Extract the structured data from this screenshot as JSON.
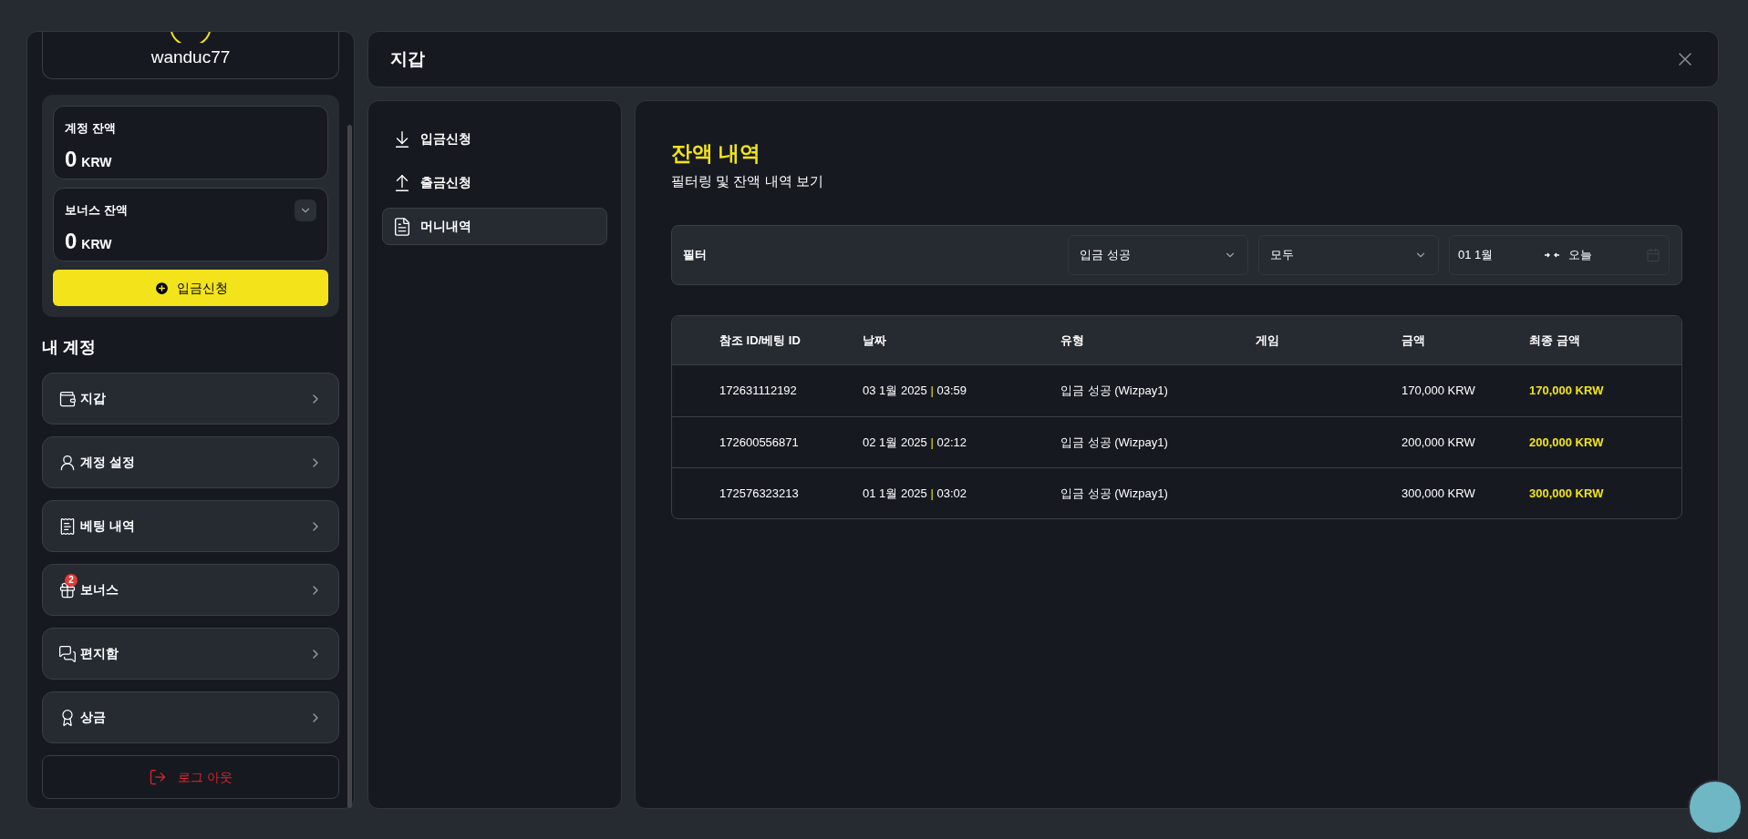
{
  "sidebar": {
    "username": "wanduc77",
    "balances": [
      {
        "label": "계정 잔액",
        "amount": "0",
        "currency": "KRW",
        "expandable": false
      },
      {
        "label": "보너스 잔액",
        "amount": "0",
        "currency": "KRW",
        "expandable": true
      }
    ],
    "deposit_button": "입금신청",
    "section_title": "내 계정",
    "items": [
      {
        "kind": "wallet",
        "label": "지갑"
      },
      {
        "kind": "account",
        "label": "계정 설정"
      },
      {
        "kind": "bets",
        "label": "베팅 내역"
      },
      {
        "kind": "bonus",
        "label": "보너스",
        "badge": "2"
      },
      {
        "kind": "inbox",
        "label": "편지함"
      },
      {
        "kind": "prize",
        "label": "상금"
      }
    ],
    "logout": "로그 아웃"
  },
  "dialog": {
    "title": "지갑",
    "nav": [
      {
        "kind": "deposit",
        "label": "입금신청",
        "selected": false
      },
      {
        "kind": "withdraw",
        "label": "출금신청",
        "selected": false
      },
      {
        "kind": "history",
        "label": "머니내역",
        "selected": true
      }
    ],
    "heading": "잔액 내역",
    "subheading": "필터링 및 잔액 내역 보기",
    "filter": {
      "label": "필터",
      "type_select": "입금 성공",
      "scope_select": "모두",
      "date_from": "01 1월",
      "date_to": "오늘"
    },
    "table": {
      "columns": [
        "참조 ID/베팅 ID",
        "날짜",
        "유형",
        "게임",
        "금액",
        "최종 금액"
      ],
      "rows": [
        {
          "id": "172631112192",
          "date": "03 1월 2025",
          "separator": "|",
          "time": "03:59",
          "type": "입금 성공 (Wizpay1)",
          "game": "",
          "amount": "170,000 KRW",
          "final": "170,000 KRW"
        },
        {
          "id": "172600556871",
          "date": "02 1월 2025",
          "separator": "|",
          "time": "02:12",
          "type": "입금 성공 (Wizpay1)",
          "game": "",
          "amount": "200,000 KRW",
          "final": "200,000 KRW"
        },
        {
          "id": "172576323213",
          "date": "01 1월 2025",
          "separator": "|",
          "time": "03:02",
          "type": "입금 성공 (Wizpay1)",
          "game": "",
          "amount": "300,000 KRW",
          "final": "300,000 KRW"
        }
      ]
    }
  }
}
